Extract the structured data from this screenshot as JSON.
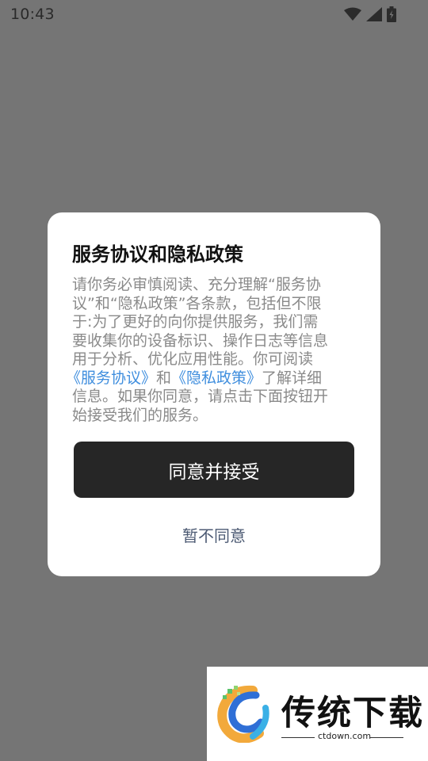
{
  "status_bar": {
    "time": "10:43",
    "icons": [
      "wifi-icon",
      "signal-icon",
      "battery-icon"
    ]
  },
  "dialog": {
    "title": "服务协议和隐私政策",
    "body_lines": [
      [
        "请你务必审慎阅读、充分理解“服务协"
      ],
      [
        "议”和“隐私政策”各条款，包括但不限"
      ],
      [
        "于:为了更好的向你提供服务，我们需"
      ],
      [
        "要收集你的设备标识、操作日志等信息"
      ],
      [
        "用于分析、优化应用性能。你可阅读"
      ],
      [
        "《服务协议》",
        "和",
        "《隐私政策》",
        "了解详细"
      ],
      [
        "信息。如果你同意，请点击下面按钮开"
      ],
      [
        "始接受我们的服务。"
      ]
    ],
    "body": {
      "line1": "请你务必审慎阅读、充分理解“服务协",
      "line2": "议”和“隐私政策”各条款，包括但不限",
      "line3": "于:为了更好的向你提供服务，我们需",
      "line4": "要收集你的设备标识、操作日志等信息",
      "line5": "用于分析、优化应用性能。你可阅读",
      "link_service": "《服务协议》",
      "and": "和",
      "link_privacy": "《隐私政策》",
      "line6_tail": "了解详细",
      "line7": "信息。如果你同意，请点击下面按钮开",
      "line8": "始接受我们的服务。"
    },
    "accept_label": "同意并接受",
    "decline_label": "暂不同意"
  },
  "colors": {
    "overlay": "#757575",
    "link": "#3f8ede",
    "accept_bg": "#262626",
    "decline_text": "#4c5a73"
  },
  "watermark": {
    "brand": "传统下载",
    "domain": "ctdown.com"
  }
}
